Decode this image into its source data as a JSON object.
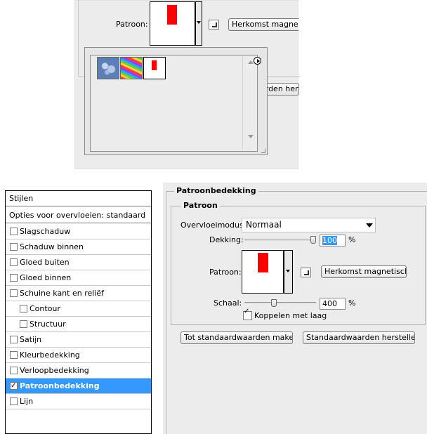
{
  "popup_picker": {
    "pattern_label": "Patroon:",
    "snap_button_label": "Herkomst magnetisch",
    "reset_button_partial": "arden herstel",
    "thumbnails": [
      {
        "name": "bubbles-pattern"
      },
      {
        "name": "rainbow-pattern"
      },
      {
        "name": "red-white-pattern"
      }
    ],
    "menu_icon": "circle-arrow-right-icon"
  },
  "styles_panel": {
    "title": "Stijlen",
    "blend_options": "Opties voor overvloeien: standaard",
    "items": [
      {
        "label": "Slagschaduw",
        "checked": false,
        "indent": false,
        "selected": false
      },
      {
        "label": "Schaduw binnen",
        "checked": false,
        "indent": false,
        "selected": false
      },
      {
        "label": "Gloed buiten",
        "checked": false,
        "indent": false,
        "selected": false
      },
      {
        "label": "Gloed binnen",
        "checked": false,
        "indent": false,
        "selected": false
      },
      {
        "label": "Schuine kant en reliëf",
        "checked": false,
        "indent": false,
        "selected": false
      },
      {
        "label": "Contour",
        "checked": false,
        "indent": true,
        "selected": false
      },
      {
        "label": "Structuur",
        "checked": false,
        "indent": true,
        "selected": false
      },
      {
        "label": "Satijn",
        "checked": false,
        "indent": false,
        "selected": false
      },
      {
        "label": "Kleurbedekking",
        "checked": false,
        "indent": false,
        "selected": false
      },
      {
        "label": "Verloopbedekking",
        "checked": false,
        "indent": false,
        "selected": false
      },
      {
        "label": "Patroonbedekking",
        "checked": true,
        "indent": false,
        "selected": true
      },
      {
        "label": "Lijn",
        "checked": false,
        "indent": false,
        "selected": false
      }
    ]
  },
  "overlay": {
    "section_title": "Patroonbedekking",
    "group_title": "Patroon",
    "blend_mode_label": "Overvloeimodus:",
    "blend_mode_value": "Normaal",
    "opacity_label": "Dekking:",
    "opacity_value": "100",
    "opacity_fraction": 1.0,
    "percent_sign": "%",
    "pattern_label": "Patroon:",
    "snap_button": "Herkomst magnetisch",
    "scale_label": "Schaal:",
    "scale_value": "400",
    "scale_fraction": 0.4,
    "link_layer_label": "Koppelen met laag",
    "link_layer_checked": true,
    "make_default_button": "Tot standaardwaarden maken",
    "reset_default_button": "Standaardwaarden herstellen"
  },
  "colors": {
    "selection": "#3399ff",
    "pattern_red": "#ff0000",
    "dialog_bg": "#ececec"
  }
}
